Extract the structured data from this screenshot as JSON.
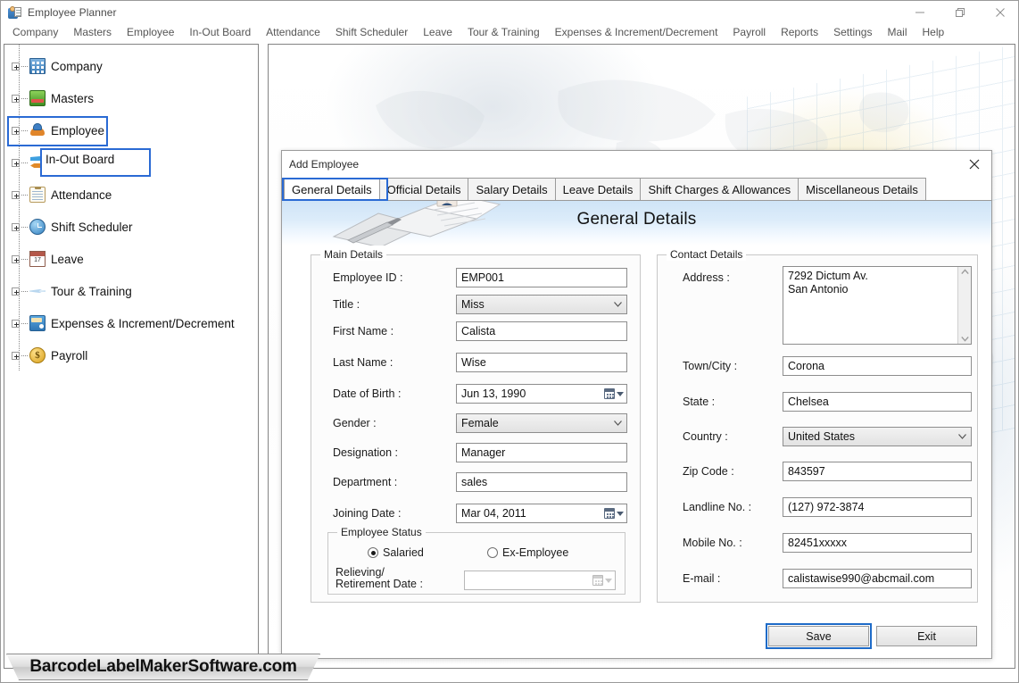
{
  "window": {
    "title": "Employee Planner",
    "icon": "employee-planner-icon",
    "minimize": "minimize-icon",
    "restore": "restore-icon",
    "close": "close-icon"
  },
  "menubar": {
    "items": [
      "Company",
      "Masters",
      "Employee",
      "In-Out Board",
      "Attendance",
      "Shift Scheduler",
      "Leave",
      "Tour & Training",
      "Expenses & Increment/Decrement",
      "Payroll",
      "Reports",
      "Settings",
      "Mail",
      "Help"
    ]
  },
  "sidebar": {
    "items": [
      {
        "label": "Company",
        "icon": "company-building-icon",
        "highlighted": false
      },
      {
        "label": "Masters",
        "icon": "masters-layers-icon",
        "highlighted": false
      },
      {
        "label": "Employee",
        "icon": "employee-group-icon",
        "highlighted": true
      },
      {
        "label": "In-Out Board",
        "icon": "in-out-arrows-icon",
        "highlighted": true
      },
      {
        "label": "Attendance",
        "icon": "attendance-clipboard-icon",
        "highlighted": false
      },
      {
        "label": "Shift Scheduler",
        "icon": "clock-icon",
        "highlighted": false
      },
      {
        "label": "Leave",
        "icon": "calendar-17-icon",
        "highlighted": false
      },
      {
        "label": "Tour & Training",
        "icon": "airplane-icon",
        "highlighted": false
      },
      {
        "label": "Expenses & Increment/Decrement",
        "icon": "wallet-icon",
        "highlighted": false
      },
      {
        "label": "Payroll",
        "icon": "dollar-coin-icon",
        "highlighted": false
      }
    ]
  },
  "dialog": {
    "title": "Add Employee",
    "close_icon": "close-icon",
    "tabs": [
      {
        "label": "General Details",
        "active": true
      },
      {
        "label": "Official Details",
        "active": false
      },
      {
        "label": "Salary Details",
        "active": false
      },
      {
        "label": "Leave Details",
        "active": false
      },
      {
        "label": "Shift Charges & Allowances",
        "active": false
      },
      {
        "label": "Miscellaneous Details",
        "active": false
      }
    ],
    "banner_title": "General Details",
    "banner_art": "open-book-with-pen-icon",
    "main_details": {
      "legend": "Main Details",
      "fields": [
        {
          "label": "Employee ID :",
          "value": "EMP001",
          "type": "text"
        },
        {
          "label": "Title :",
          "value": "Miss",
          "type": "select"
        },
        {
          "label": "First Name :",
          "value": "Calista",
          "type": "text"
        },
        {
          "label": "Last Name :",
          "value": "Wise",
          "type": "text"
        },
        {
          "label": "Date of Birth :",
          "value": "Jun 13, 1990",
          "type": "date"
        },
        {
          "label": "Gender :",
          "value": "Female",
          "type": "select"
        },
        {
          "label": "Designation :",
          "value": "Manager",
          "type": "text"
        },
        {
          "label": "Department :",
          "value": "sales",
          "type": "text"
        },
        {
          "label": "Joining Date :",
          "value": "Mar 04, 2011",
          "type": "date"
        }
      ],
      "employee_status": {
        "legend": "Employee Status",
        "options": [
          {
            "label": "Salaried",
            "selected": true
          },
          {
            "label": "Ex-Employee",
            "selected": false
          }
        ],
        "relieving_label_line1": "Relieving/",
        "relieving_label_line2": "Retirement Date :",
        "relieving_value": "",
        "relieving_disabled": true
      }
    },
    "contact_details": {
      "legend": "Contact Details",
      "address_label": "Address :",
      "address_value": "7292 Dictum Av.\nSan Antonio",
      "fields": [
        {
          "label": "Town/City :",
          "value": "Corona",
          "type": "text"
        },
        {
          "label": "State :",
          "value": "Chelsea",
          "type": "text"
        },
        {
          "label": "Country :",
          "value": "United States",
          "type": "select"
        },
        {
          "label": "Zip Code :",
          "value": "843597",
          "type": "text"
        },
        {
          "label": "Landline No. :",
          "value": "(127) 972-3874",
          "type": "text"
        },
        {
          "label": "Mobile No. :",
          "value": "82451xxxxx",
          "type": "text"
        },
        {
          "label": "E-mail :",
          "value": "calistawise990@abcmail.com",
          "type": "text"
        }
      ]
    },
    "buttons": {
      "save": "Save",
      "exit": "Exit"
    }
  },
  "watermark": "BarcodeLabelMakerSoftware.com",
  "colors": {
    "highlight_blue": "#2a6ad4",
    "focus_blue": "#1e6bc8",
    "banner_top": "#cfe4f7",
    "border_gray": "#8d8d8d"
  }
}
